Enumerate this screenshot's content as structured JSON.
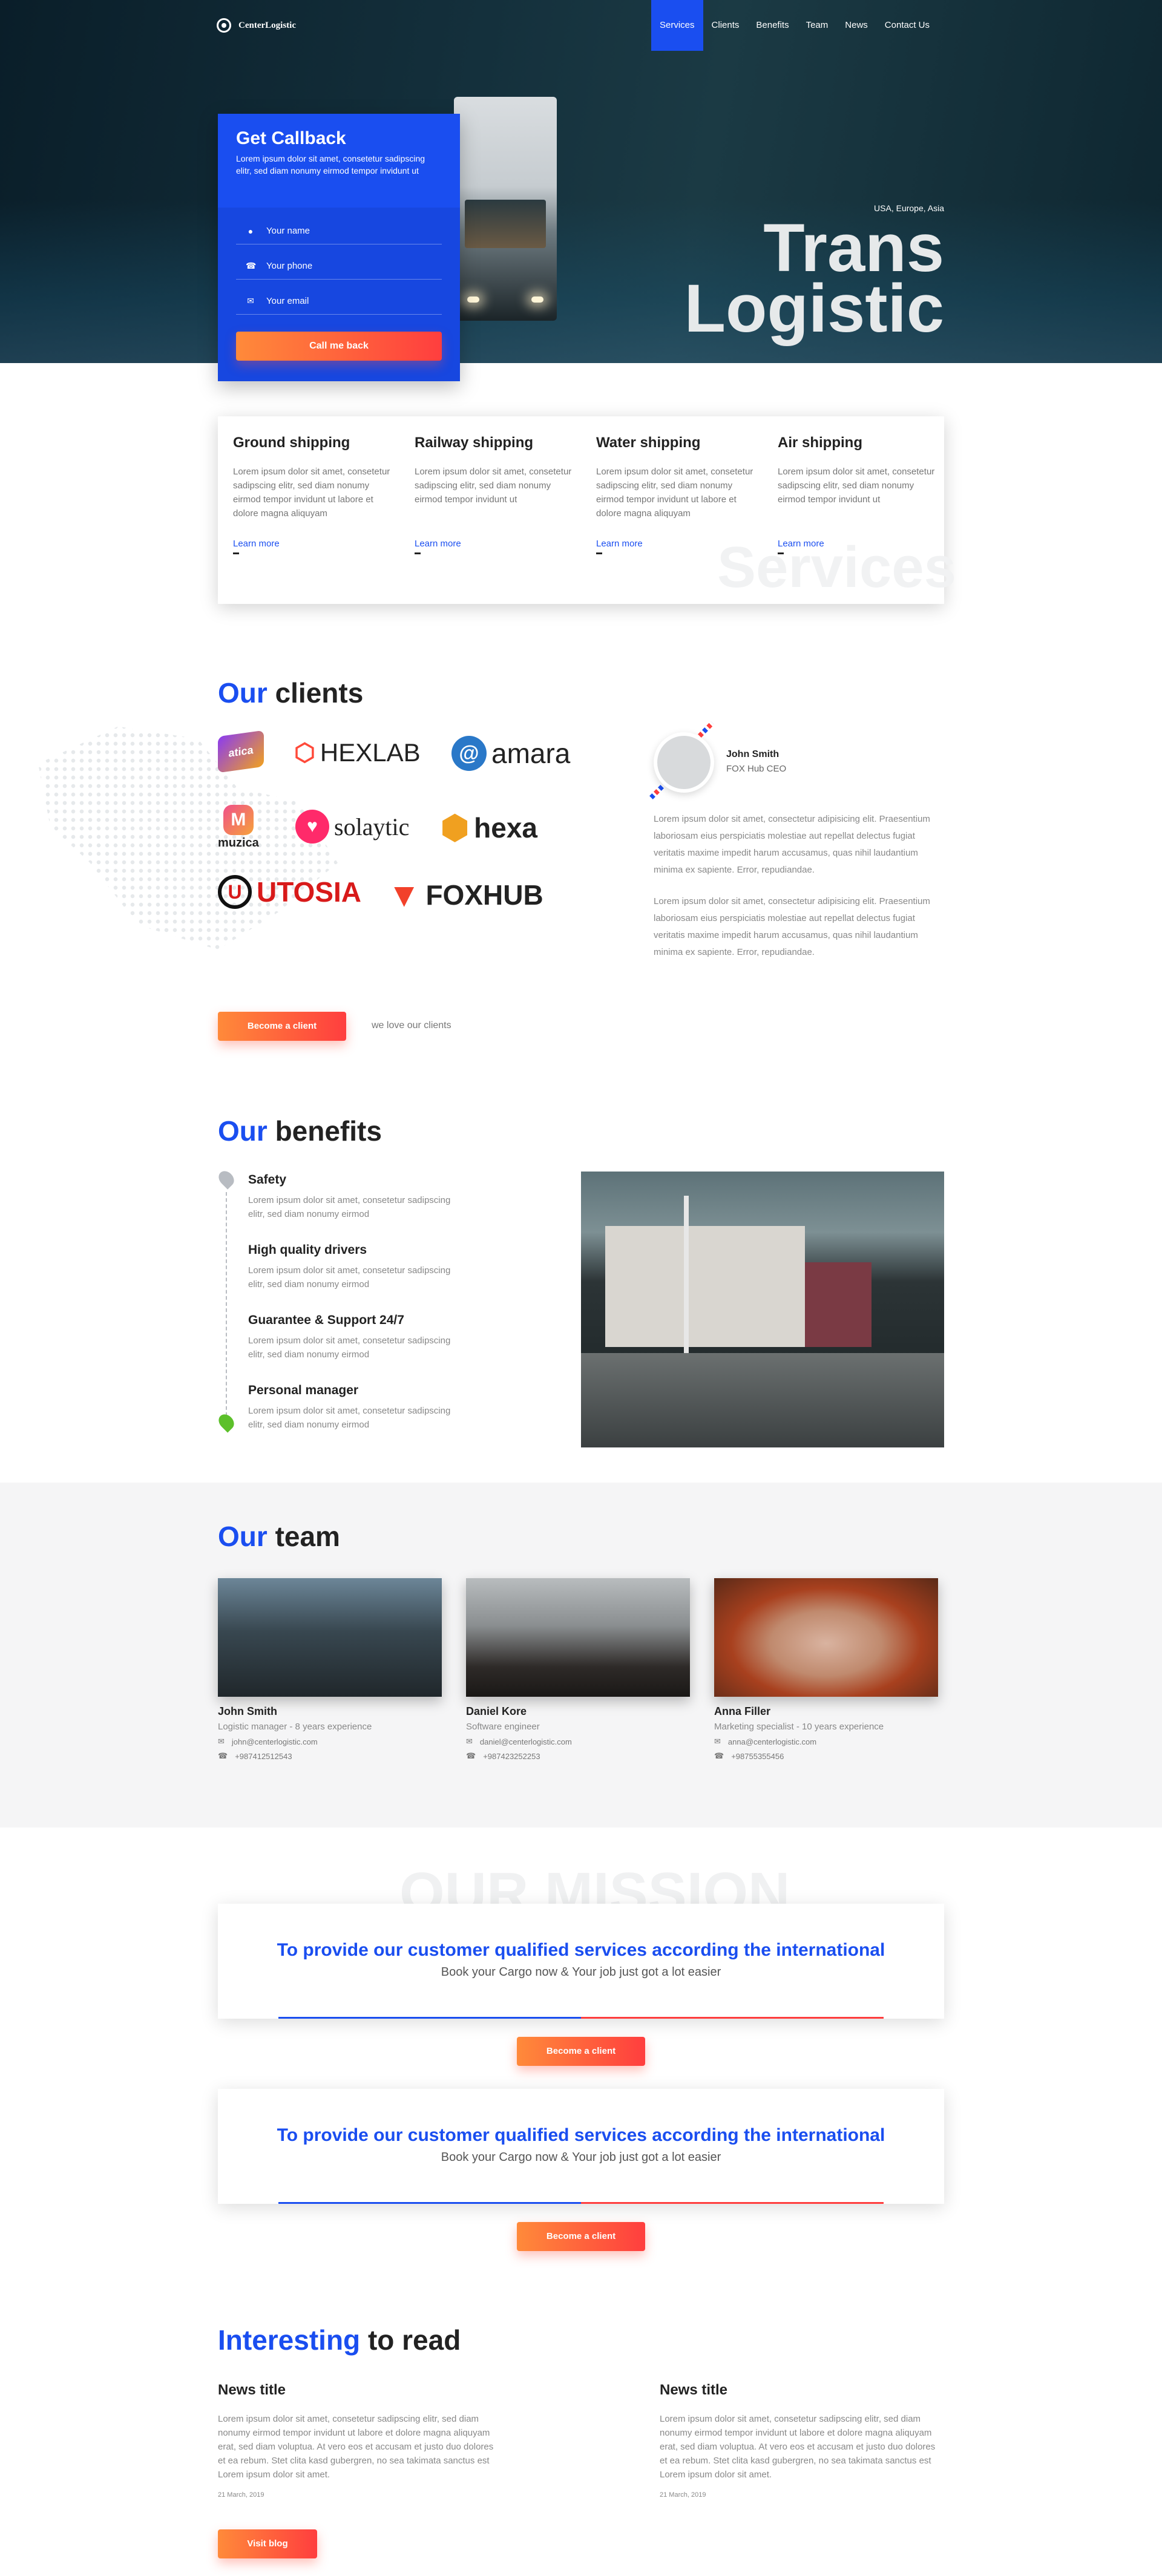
{
  "header": {
    "logo_text": "CenterLogistic",
    "nav": [
      "Services",
      "Clients",
      "Benefits",
      "Team",
      "News",
      "Contact Us"
    ],
    "active_nav": "Services"
  },
  "hero": {
    "region": "USA, Europe, Asia",
    "title_line1": "Trans",
    "title_line2": "Logistic"
  },
  "callback": {
    "title": "Get Callback",
    "description": "Lorem ipsum dolor sit amet, consetetur sadipscing elitr, sed diam nonumy eirmod tempor invidunt ut",
    "name_placeholder": "Your name",
    "phone_placeholder": "Your phone",
    "email_placeholder": "Your email",
    "button": "Call me back"
  },
  "services": {
    "bg_title": "Services",
    "items": [
      {
        "title": "Ground shipping",
        "text": "Lorem ipsum dolor sit amet, consetetur sadipscing elitr, sed diam nonumy eirmod tempor invidunt ut labore et dolore magna aliquyam",
        "link": "Learn more"
      },
      {
        "title": "Railway shipping",
        "text": "Lorem ipsum dolor sit amet, consetetur sadipscing elitr, sed diam nonumy eirmod tempor invidunt ut",
        "link": "Learn more"
      },
      {
        "title": "Water shipping",
        "text": "Lorem ipsum dolor sit amet, consetetur sadipscing elitr, sed diam nonumy eirmod tempor invidunt ut labore et dolore magna aliquyam",
        "link": "Learn more"
      },
      {
        "title": "Air shipping",
        "text": "Lorem ipsum dolor sit amet, consetetur sadipscing elitr, sed diam nonumy eirmod tempor invidunt ut",
        "link": "Learn more"
      }
    ]
  },
  "clients": {
    "title_accent": "Our",
    "title_rest": "clients",
    "logos": [
      "atica",
      "HEXLAB",
      "amara",
      "muzica",
      "solaytic",
      "hexa",
      "UTOSIA",
      "FOXHUB"
    ],
    "testimonial": {
      "name": "John Smith",
      "role": "FOX Hub CEO",
      "p1": "Lorem ipsum dolor sit amet, consectetur adipisicing elit. Praesentium laboriosam eius perspiciatis molestiae aut repellat delectus fugiat veritatis maxime impedit harum accusamus, quas nihil laudantium minima ex sapiente. Error, repudiandae.",
      "p2": "Lorem ipsum dolor sit amet, consectetur adipisicing elit. Praesentium laboriosam eius perspiciatis molestiae aut repellat delectus fugiat veritatis maxime impedit harum accusamus, quas nihil laudantium minima ex sapiente. Error, repudiandae."
    },
    "button": "Become a client",
    "note": "we love our clients"
  },
  "benefits": {
    "title_accent": "Our",
    "title_rest": "benefits",
    "items": [
      {
        "title": "Safety",
        "text": "Lorem ipsum dolor sit amet, consetetur sadipscing elitr, sed diam nonumy eirmod"
      },
      {
        "title": "High quality drivers",
        "text": "Lorem ipsum dolor sit amet, consetetur sadipscing elitr, sed diam nonumy eirmod"
      },
      {
        "title": "Guarantee & Support 24/7",
        "text": "Lorem ipsum dolor sit amet, consetetur sadipscing elitr, sed diam nonumy eirmod"
      },
      {
        "title": "Personal manager",
        "text": "Lorem ipsum dolor sit amet, consetetur sadipscing elitr, sed diam nonumy eirmod"
      }
    ]
  },
  "team": {
    "title_accent": "Our",
    "title_rest": "team",
    "members": [
      {
        "name": "John Smith",
        "role": "Logistic manager - 8 years experience",
        "email": "john@centerlogistic.com",
        "phone": "+987412512543"
      },
      {
        "name": "Daniel Kore",
        "role": "Software engineer",
        "email": "daniel@centerlogistic.com",
        "phone": "+987423252253"
      },
      {
        "name": "Anna Filler",
        "role": "Marketing specialist - 10 years experience",
        "email": "anna@centerlogistic.com",
        "phone": "+98755355456"
      }
    ]
  },
  "mission": {
    "bg_title": "OUR MISSION",
    "cards": [
      {
        "title": "To provide our customer qualified services according the international",
        "subtitle": "Book your Cargo now & Your job just got a lot easier",
        "button": "Become a client"
      },
      {
        "title": "To provide our customer qualified services according the international",
        "subtitle": "Book your Cargo now & Your job just got a lot easier",
        "button": "Become a client"
      }
    ]
  },
  "news": {
    "title_accent": "Interesting",
    "title_rest": "to read",
    "items": [
      {
        "title": "News title",
        "text": "Lorem ipsum dolor sit amet, consetetur sadipscing elitr, sed diam nonumy eirmod tempor invidunt ut labore et dolore magna aliquyam erat, sed diam voluptua. At vero eos et accusam et justo duo dolores et ea rebum. Stet clita kasd gubergren, no sea takimata sanctus est Lorem ipsum dolor sit amet.",
        "date": "21 March, 2019"
      },
      {
        "title": "News title",
        "text": "Lorem ipsum dolor sit amet, consetetur sadipscing elitr, sed diam nonumy eirmod tempor invidunt ut labore et dolore magna aliquyam erat, sed diam voluptua. At vero eos et accusam et justo duo dolores et ea rebum. Stet clita kasd gubergren, no sea takimata sanctus est Lorem ipsum dolor sit amet.",
        "date": "21 March, 2019"
      }
    ],
    "button": "Visit blog"
  },
  "colors": {
    "accent": "#1a4ef0",
    "cta_start": "#ff8a3a",
    "cta_end": "#ff3e3e"
  }
}
